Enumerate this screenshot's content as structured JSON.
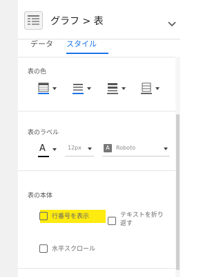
{
  "header": {
    "title": "グラフ > 表",
    "chart_icon": "table-chart-icon",
    "expand_icon": "chevron-down-icon"
  },
  "tabs": [
    {
      "label": "データ"
    },
    {
      "label": "スタイル",
      "active": true
    }
  ],
  "table_colors": {
    "title": "表の色",
    "buttons": [
      {
        "icon": "header-color-icon",
        "underline_color": "#1a73e8"
      },
      {
        "icon": "row-color-icon",
        "underline_color": "#1a73e8"
      },
      {
        "icon": "alt-row-color-icon",
        "underline_color": "#666666"
      },
      {
        "icon": "border-color-icon",
        "underline_color": "#666666"
      }
    ]
  },
  "table_labels": {
    "title": "表のラベル",
    "text_color_glyph": "A",
    "text_color_underline": "#000000",
    "font_size": "12px",
    "font_family": "Roboto",
    "font_family_badge": "A"
  },
  "table_body": {
    "title": "表の本体",
    "checkboxes": [
      {
        "label": "行番号を表示",
        "checked": false,
        "highlighted": true
      },
      {
        "label": "テキストを折り返す",
        "checked": false
      },
      {
        "label": "水平スクロール",
        "checked": false
      }
    ]
  },
  "colors": {
    "accent": "#1a73e8",
    "highlight": "#ffeb10"
  }
}
